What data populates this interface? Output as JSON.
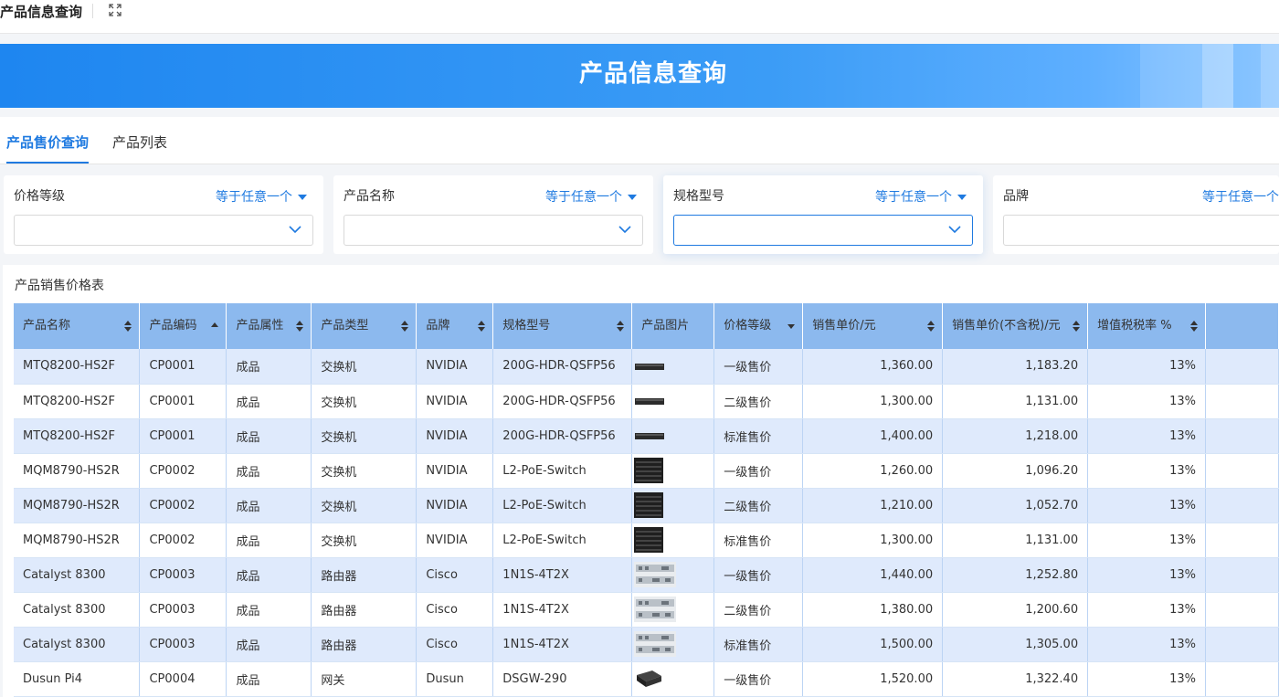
{
  "page": {
    "tab_title": "产品信息查询",
    "banner_title": "产品信息查询"
  },
  "tabs": [
    {
      "label": "产品售价查询",
      "active": true
    },
    {
      "label": "产品列表",
      "active": false
    }
  ],
  "filters": [
    {
      "label": "价格等级",
      "operator": "等于任意一个",
      "value": ""
    },
    {
      "label": "产品名称",
      "operator": "等于任意一个",
      "value": ""
    },
    {
      "label": "规格型号",
      "operator": "等于任意一个",
      "value": ""
    },
    {
      "label": "品牌",
      "operator": "等于任意一个",
      "value": ""
    }
  ],
  "table": {
    "title": "产品销售价格表",
    "columns": [
      "产品名称",
      "产品编码",
      "产品属性",
      "产品类型",
      "品牌",
      "规格型号",
      "产品图片",
      "价格等级",
      "销售单价/元",
      "销售单价(不含税)/元",
      "增值税税率 %",
      ""
    ],
    "rows": [
      {
        "name": "MTQ8200-HS2F",
        "code": "CP0001",
        "attr": "成品",
        "type": "交换机",
        "brand": "NVIDIA",
        "model": "200G-HDR-QSFP56",
        "image": "switch-flat",
        "level": "一级售价",
        "price": "1,360.00",
        "price_ex": "1,183.20",
        "vat": "13%"
      },
      {
        "name": "MTQ8200-HS2F",
        "code": "CP0001",
        "attr": "成品",
        "type": "交换机",
        "brand": "NVIDIA",
        "model": "200G-HDR-QSFP56",
        "image": "switch-flat",
        "level": "二级售价",
        "price": "1,300.00",
        "price_ex": "1,131.00",
        "vat": "13%"
      },
      {
        "name": "MTQ8200-HS2F",
        "code": "CP0001",
        "attr": "成品",
        "type": "交换机",
        "brand": "NVIDIA",
        "model": "200G-HDR-QSFP56",
        "image": "switch-flat",
        "level": "标准售价",
        "price": "1,400.00",
        "price_ex": "1,218.00",
        "vat": "13%"
      },
      {
        "name": "MQM8790-HS2R",
        "code": "CP0002",
        "attr": "成品",
        "type": "交换机",
        "brand": "NVIDIA",
        "model": "L2-PoE-Switch",
        "image": "switch-stack",
        "level": "一级售价",
        "price": "1,260.00",
        "price_ex": "1,096.20",
        "vat": "13%"
      },
      {
        "name": "MQM8790-HS2R",
        "code": "CP0002",
        "attr": "成品",
        "type": "交换机",
        "brand": "NVIDIA",
        "model": "L2-PoE-Switch",
        "image": "switch-stack",
        "level": "二级售价",
        "price": "1,210.00",
        "price_ex": "1,052.70",
        "vat": "13%"
      },
      {
        "name": "MQM8790-HS2R",
        "code": "CP0002",
        "attr": "成品",
        "type": "交换机",
        "brand": "NVIDIA",
        "model": "L2-PoE-Switch",
        "image": "switch-stack",
        "level": "标准售价",
        "price": "1,300.00",
        "price_ex": "1,131.00",
        "vat": "13%"
      },
      {
        "name": "Catalyst 8300",
        "code": "CP0003",
        "attr": "成品",
        "type": "路由器",
        "brand": "Cisco",
        "model": "1N1S-4T2X",
        "image": "router",
        "level": "一级售价",
        "price": "1,440.00",
        "price_ex": "1,252.80",
        "vat": "13%"
      },
      {
        "name": "Catalyst 8300",
        "code": "CP0003",
        "attr": "成品",
        "type": "路由器",
        "brand": "Cisco",
        "model": "1N1S-4T2X",
        "image": "router",
        "level": "二级售价",
        "price": "1,380.00",
        "price_ex": "1,200.60",
        "vat": "13%"
      },
      {
        "name": "Catalyst 8300",
        "code": "CP0003",
        "attr": "成品",
        "type": "路由器",
        "brand": "Cisco",
        "model": "1N1S-4T2X",
        "image": "router",
        "level": "标准售价",
        "price": "1,500.00",
        "price_ex": "1,305.00",
        "vat": "13%"
      },
      {
        "name": "Dusun Pi4",
        "code": "CP0004",
        "attr": "成品",
        "type": "网关",
        "brand": "Dusun",
        "model": "DSGW-290",
        "image": "gateway-box",
        "level": "一级售价",
        "price": "1,520.00",
        "price_ex": "1,322.40",
        "vat": "13%"
      }
    ]
  },
  "colors": {
    "accent": "#1f7ae0",
    "header_bg": "#8cb9ee",
    "row_alt": "#dfeafc"
  }
}
